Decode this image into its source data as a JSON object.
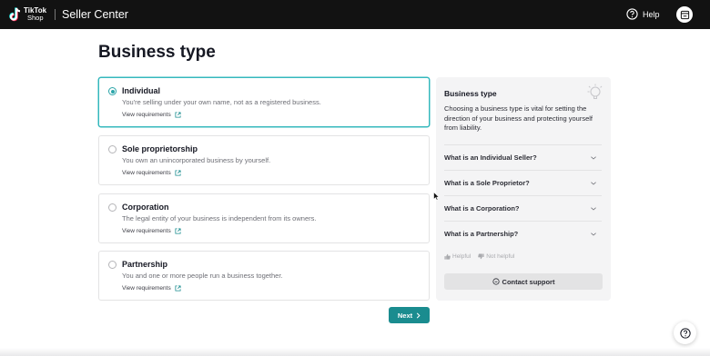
{
  "header": {
    "brand_top": "TikTok",
    "brand_bottom": "Shop",
    "app_title": "Seller Center",
    "help_label": "Help"
  },
  "page": {
    "title": "Business type"
  },
  "options": [
    {
      "title": "Individual",
      "description": "You're selling under your own name, not as a registered business.",
      "link": "View requirements",
      "selected": true
    },
    {
      "title": "Sole proprietorship",
      "description": "You own an unincorporated business by yourself.",
      "link": "View requirements",
      "selected": false
    },
    {
      "title": "Corporation",
      "description": "The legal entity of your business is independent from its owners.",
      "link": "View requirements",
      "selected": false
    },
    {
      "title": "Partnership",
      "description": "You and one or more people run a business together.",
      "link": "View requirements",
      "selected": false
    }
  ],
  "actions": {
    "next_label": "Next"
  },
  "panel": {
    "title": "Business type",
    "text": "Choosing a business type is vital for setting the direction of your business and protecting yourself from liability.",
    "faqs": [
      "What is an Individual Seller?",
      "What is a Sole Proprietor?",
      "What is a Corporation?",
      "What is a Partnership?"
    ],
    "helpful_label": "Helpful",
    "not_helpful_label": "Not helpful",
    "contact_label": "Contact support"
  },
  "colors": {
    "accent": "#1a8c8f",
    "selected_border": "#35b8bd",
    "header_bg": "#121212"
  }
}
